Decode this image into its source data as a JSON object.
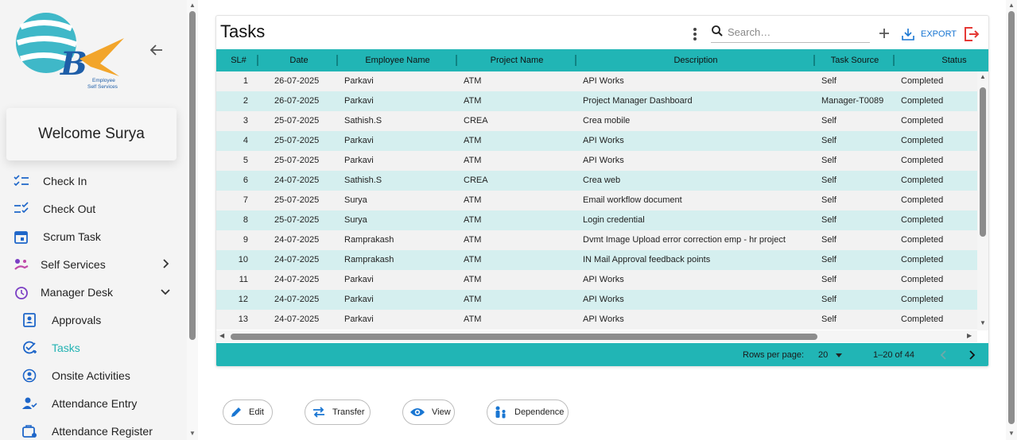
{
  "sidebar": {
    "logo_text": "Employee Self Services",
    "welcome": "Welcome Surya",
    "items": [
      {
        "label": "Check In"
      },
      {
        "label": "Check Out"
      },
      {
        "label": "Scrum Task"
      },
      {
        "label": "Self Services"
      },
      {
        "label": "Manager Desk"
      },
      {
        "label": "Approvals"
      },
      {
        "label": "Tasks"
      },
      {
        "label": "Onsite Activities"
      },
      {
        "label": "Attendance Entry"
      },
      {
        "label": "Attendance Register"
      }
    ]
  },
  "panel": {
    "title": "Tasks",
    "search_placeholder": "Search…",
    "export_label": "EXPORT"
  },
  "table": {
    "columns": [
      "SL#",
      "Date",
      "Employee Name",
      "Project Name",
      "Description",
      "Task Source",
      "Status"
    ],
    "rows": [
      [
        "1",
        "26-07-2025",
        "Parkavi",
        "ATM",
        "API Works",
        "Self",
        "Completed"
      ],
      [
        "2",
        "26-07-2025",
        "Parkavi",
        "ATM",
        "Project Manager Dashboard",
        "Manager-T0089",
        "Completed"
      ],
      [
        "3",
        "25-07-2025",
        "Sathish.S",
        "CREA",
        "Crea mobile",
        "Self",
        "Completed"
      ],
      [
        "4",
        "25-07-2025",
        "Parkavi",
        "ATM",
        "API Works",
        "Self",
        "Completed"
      ],
      [
        "5",
        "25-07-2025",
        "Parkavi",
        "ATM",
        "API Works",
        "Self",
        "Completed"
      ],
      [
        "6",
        "24-07-2025",
        "Sathish.S",
        "CREA",
        "Crea web",
        "Self",
        "Completed"
      ],
      [
        "7",
        "25-07-2025",
        "Surya",
        "ATM",
        "Email workflow document",
        "Self",
        "Completed"
      ],
      [
        "8",
        "25-07-2025",
        "Surya",
        "ATM",
        "Login credential",
        "Self",
        "Completed"
      ],
      [
        "9",
        "24-07-2025",
        "Ramprakash",
        "ATM",
        "Dvmt Image Upload error correction emp - hr project",
        "Self",
        "Completed"
      ],
      [
        "10",
        "24-07-2025",
        "Ramprakash",
        "ATM",
        "IN Mail Approval feedback points",
        "Self",
        "Completed"
      ],
      [
        "11",
        "24-07-2025",
        "Parkavi",
        "ATM",
        "API Works",
        "Self",
        "Completed"
      ],
      [
        "12",
        "24-07-2025",
        "Parkavi",
        "ATM",
        "API Works",
        "Self",
        "Completed"
      ],
      [
        "13",
        "24-07-2025",
        "Parkavi",
        "ATM",
        "API Works",
        "Self",
        "Completed"
      ]
    ]
  },
  "pager": {
    "rows_per_page_label": "Rows per page:",
    "rows_per_page_value": "20",
    "range": "1–20 of 44"
  },
  "actions": {
    "edit": "Edit",
    "transfer": "Transfer",
    "view": "View",
    "dependence": "Dependence"
  },
  "colors": {
    "accent": "#21b5b5",
    "row_alt": "#d5efef",
    "link": "#1976d2",
    "logout": "#e53935"
  }
}
